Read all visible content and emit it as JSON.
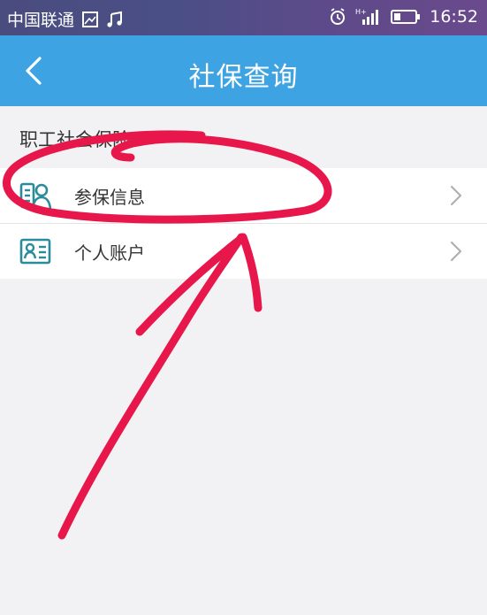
{
  "status_bar": {
    "carrier": "中国联通",
    "time": "16:52",
    "network": "H+",
    "icons": [
      "image-icon",
      "music-icon",
      "alarm-icon",
      "signal-icon",
      "battery-icon"
    ]
  },
  "header": {
    "title": "社保查询",
    "back_icon": "chevron-left-icon",
    "background": "#3da3e3"
  },
  "section": {
    "title": "职工社会保险"
  },
  "list": {
    "items": [
      {
        "label": "参保信息",
        "icon": "person-card-icon"
      },
      {
        "label": "个人账户",
        "icon": "id-card-icon"
      }
    ]
  },
  "colors": {
    "accent": "#3da3e3",
    "icon_teal": "#2a8c9a",
    "annotation_red": "#e8174b"
  }
}
